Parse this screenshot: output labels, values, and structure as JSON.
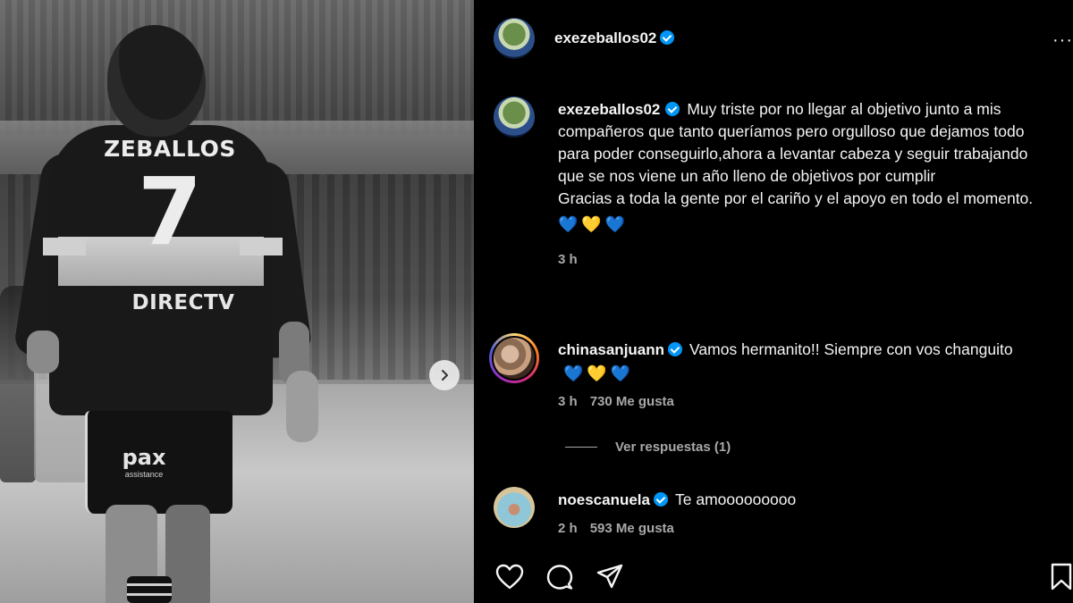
{
  "photo": {
    "jersey_name": "ZEBALLOS",
    "jersey_number": "7",
    "sponsor": "DIRECTV",
    "shorts_logo": "pax",
    "shorts_logo_sub": "assistance"
  },
  "post": {
    "author": "exezeballos02",
    "caption": {
      "username": "exezeballos02",
      "text_line1": "Muy triste por no llegar al objetivo junto a mis compañeros que tanto queríamos pero orgulloso que dejamos todo para poder conseguirlo,ahora a levantar cabeza y seguir trabajando que se nos viene un año lleno de objetivos por cumplir",
      "text_line2": "Gracias a toda la gente por el cariño y el apoyo en todo el momento.",
      "emojis": [
        "💙",
        "💛",
        "💙"
      ],
      "time": "3 h"
    },
    "comments": [
      {
        "username": "chinasanjuann",
        "text": "Vamos hermanito!! Siempre con vos changuito",
        "emojis": [
          "💙",
          "💛",
          "💙"
        ],
        "time": "3 h",
        "likes": "730 Me gusta",
        "view_replies": "Ver respuestas (1)"
      },
      {
        "username": "noescanuela",
        "text": "Te amooooooooo",
        "time": "2 h",
        "likes": "593 Me gusta"
      }
    ]
  },
  "colors": {
    "verified": "#0095f6",
    "heart_blue": "#1877f2",
    "heart_yellow": "#f8d210",
    "meta_gray": "#a8a8a8"
  },
  "icons": [
    "more-icon",
    "next-arrow-icon",
    "heart-icon",
    "comment-icon",
    "share-icon",
    "bookmark-icon",
    "verified-icon"
  ]
}
